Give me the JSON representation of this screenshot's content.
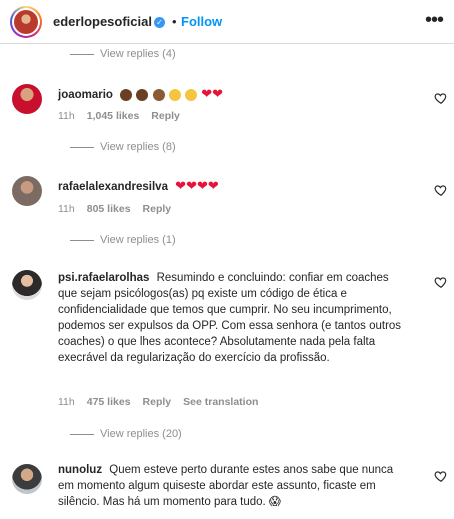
{
  "header": {
    "username": "ederlopesoficial",
    "separator": "•",
    "follow_label": "Follow",
    "more_icon": "•••"
  },
  "replies": [
    {
      "label": "View replies (4)"
    },
    {
      "label": "View replies (8)"
    },
    {
      "label": "View replies (1)"
    },
    {
      "label": "View replies (20)"
    }
  ],
  "comments": [
    {
      "username": "joaomario",
      "text": "",
      "time": "11h",
      "likes": "1,045 likes",
      "reply_label": "Reply"
    },
    {
      "username": "rafaelalexandresilva",
      "text": "",
      "time": "11h",
      "likes": "805 likes",
      "reply_label": "Reply"
    },
    {
      "username": "psi.rafaelarolhas",
      "text": "Resumindo e concluindo: confiar em coaches que sejam psicólogos(as) pq existe um código de ética e confidencialidade que temos que cumprir. No seu incumprimento, podemos ser expulsos da OPP. Com essa senhora (e tantos outros coaches) o que lhes acontece? Absolutamente nada pela falta execrável da regularização do exercício da profissão.",
      "time": "11h",
      "likes": "475 likes",
      "reply_label": "Reply",
      "translate_label": "See translation"
    },
    {
      "username": "nunoluz",
      "text": "Quem esteve perto durante estes anos sabe que nunca em momento algum quiseste abordar este assunto, ficaste em silêncio. Mas há um momento para tudo. 😱"
    }
  ],
  "colors": {
    "link_blue": "#0095f6",
    "verified_blue": "#3897f0",
    "muted": "#8e8e8e",
    "heart_red": "#e8123a"
  }
}
